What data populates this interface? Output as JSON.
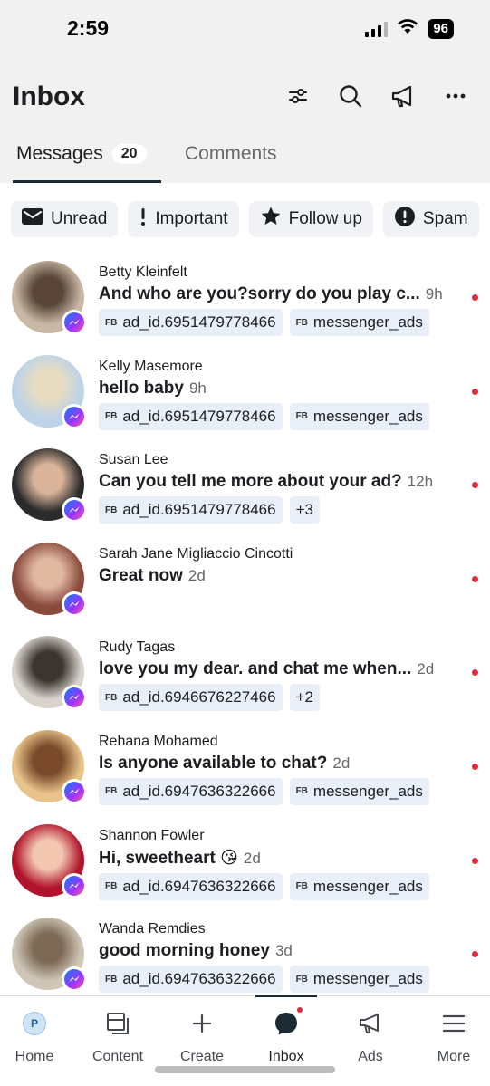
{
  "status_bar": {
    "time": "2:59",
    "battery": "96"
  },
  "header": {
    "title": "Inbox"
  },
  "tabs": {
    "messages_label": "Messages",
    "messages_count": "20",
    "comments_label": "Comments"
  },
  "filters": [
    {
      "label": "Unread",
      "icon": "envelope-icon"
    },
    {
      "label": "Important",
      "icon": "exclamation-icon"
    },
    {
      "label": "Follow up",
      "icon": "star-icon"
    },
    {
      "label": "Spam",
      "icon": "alert-circle-icon"
    }
  ],
  "tag_prefix": "FB",
  "conversations": [
    {
      "name": "Betty Kleinfelt",
      "preview": "And who are you?sorry do you play c...",
      "time": "9h",
      "tags": [
        "ad_id.6951479778466",
        "messenger_ads"
      ],
      "avatar_colors": [
        "#c9b8a6",
        "#5a4638"
      ]
    },
    {
      "name": "Kelly Masemore",
      "preview": "hello baby",
      "time": "9h",
      "tags": [
        "ad_id.6951479778466",
        "messenger_ads"
      ],
      "avatar_colors": [
        "#bcd3e8",
        "#e8dcc0"
      ]
    },
    {
      "name": "Susan Lee",
      "preview": "Can you tell me more about your ad?",
      "time": "12h",
      "tags": [
        "ad_id.6951479778466",
        "+3"
      ],
      "avatar_colors": [
        "#2b2b2b",
        "#d9b49a"
      ]
    },
    {
      "name": "Sarah Jane Migliaccio Cincotti",
      "preview": "Great now",
      "time": "2d",
      "tags": [],
      "avatar_colors": [
        "#8a4b3c",
        "#e0b8a0"
      ]
    },
    {
      "name": "Rudy Tagas",
      "preview": "love you my dear. and chat me when...",
      "time": "2d",
      "tags": [
        "ad_id.6946676227466",
        "+2"
      ],
      "avatar_colors": [
        "#d8d4cc",
        "#3b3430"
      ]
    },
    {
      "name": "Rehana Mohamed",
      "preview": "Is anyone available to chat?",
      "time": "2d",
      "tags": [
        "ad_id.6947636322666",
        "messenger_ads"
      ],
      "avatar_colors": [
        "#e8c38a",
        "#7a4a2a"
      ]
    },
    {
      "name": "Shannon Fowler",
      "preview": "Hi, sweetheart 😘",
      "time": "2d",
      "tags": [
        "ad_id.6947636322666",
        "messenger_ads"
      ],
      "avatar_colors": [
        "#b0142c",
        "#f2c7b0"
      ]
    },
    {
      "name": "Wanda Remdies",
      "preview": "good morning honey",
      "time": "3d",
      "tags": [
        "ad_id.6947636322666",
        "messenger_ads"
      ],
      "avatar_colors": [
        "#cfc6b8",
        "#7d6a55"
      ]
    }
  ],
  "bottom_nav": [
    {
      "label": "Home",
      "icon": "profile-icon"
    },
    {
      "label": "Content",
      "icon": "content-icon"
    },
    {
      "label": "Create",
      "icon": "plus-icon"
    },
    {
      "label": "Inbox",
      "icon": "chat-bubble-icon"
    },
    {
      "label": "Ads",
      "icon": "megaphone-icon"
    },
    {
      "label": "More",
      "icon": "menu-icon"
    }
  ],
  "home_avatar_letter": "P",
  "colors": {
    "accent_dark": "#1c2b33",
    "unread_dot": "#e4283c",
    "tag_bg": "#e8eff8",
    "chip_bg": "#f0f2f5"
  }
}
